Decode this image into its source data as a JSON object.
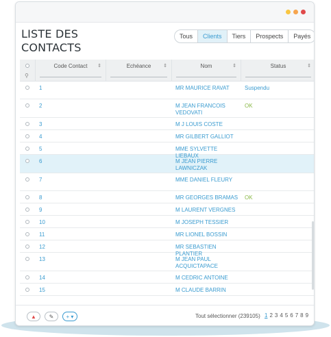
{
  "colors": {
    "red_dot": "#f6a54e",
    "yellow_dot": "#f9c642",
    "green_dot": "#e04a4a",
    "accent": "#3a9bd0",
    "ok": "#8ab847"
  },
  "window": {
    "title_line1": "LISTE DES",
    "title_line2": "CONTACTS"
  },
  "tabs": [
    {
      "label": "Tous"
    },
    {
      "label": "Clients"
    },
    {
      "label": "Tiers"
    },
    {
      "label": "Prospects"
    },
    {
      "label": "Payés"
    }
  ],
  "columns": {
    "code": "Code Contact",
    "echeance": "Echéance",
    "nom": "Nom",
    "status": "Status"
  },
  "rows": [
    {
      "code": "1",
      "echeance": "",
      "nom": "MR MAURICE RAVAT",
      "status": "Suspendu",
      "status_type": "suspendu"
    },
    {
      "code": "2",
      "echeance": "",
      "nom": "M JEAN FRANCOIS VEDOVATI",
      "status": "OK",
      "status_type": "ok"
    },
    {
      "code": "3",
      "echeance": "",
      "nom": "M J LOUIS COSTE",
      "status": "",
      "status_type": ""
    },
    {
      "code": "4",
      "echeance": "",
      "nom": "MR GILBERT GALLIOT",
      "status": "",
      "status_type": ""
    },
    {
      "code": "5",
      "echeance": "",
      "nom": "MME SYLVETTE LIEBAUX",
      "status": "",
      "status_type": ""
    },
    {
      "code": "6",
      "echeance": "",
      "nom": "M JEAN PIERRE LAWNICZAK",
      "status": "",
      "status_type": ""
    },
    {
      "code": "7",
      "echeance": "",
      "nom": "MME DANIEL FLEURY",
      "status": "",
      "status_type": ""
    },
    {
      "code": "8",
      "echeance": "",
      "nom": "MR GEORGES BRAMAS",
      "status": "OK",
      "status_type": "ok"
    },
    {
      "code": "9",
      "echeance": "",
      "nom": "M LAURENT VERGNES",
      "status": "",
      "status_type": ""
    },
    {
      "code": "10",
      "echeance": "",
      "nom": "M JOSEPH TESSIER",
      "status": "",
      "status_type": ""
    },
    {
      "code": "11",
      "echeance": "",
      "nom": "MR LIONEL BOSSIN",
      "status": "",
      "status_type": ""
    },
    {
      "code": "12",
      "echeance": "",
      "nom": "MR SEBASTIEN PLANTIER",
      "status": "",
      "status_type": ""
    },
    {
      "code": "13",
      "echeance": "",
      "nom": "M JEAN PAUL ACQUICTAPACE",
      "status": "",
      "status_type": ""
    },
    {
      "code": "14",
      "echeance": "",
      "nom": "M CEDRIC ANTOINE",
      "status": "",
      "status_type": ""
    },
    {
      "code": "15",
      "echeance": "",
      "nom": "M CLAUDE BARRIN",
      "status": "",
      "status_type": ""
    }
  ],
  "footer": {
    "selected_text": "Tout sélectionner (239105)",
    "pages": [
      "1",
      "2",
      "3",
      "4",
      "5",
      "6",
      "7",
      "8",
      "9"
    ],
    "current_page": "1",
    "delete_icon": "trash-icon",
    "edit_icon": "pencil-icon",
    "add_label": "+ ▾"
  }
}
